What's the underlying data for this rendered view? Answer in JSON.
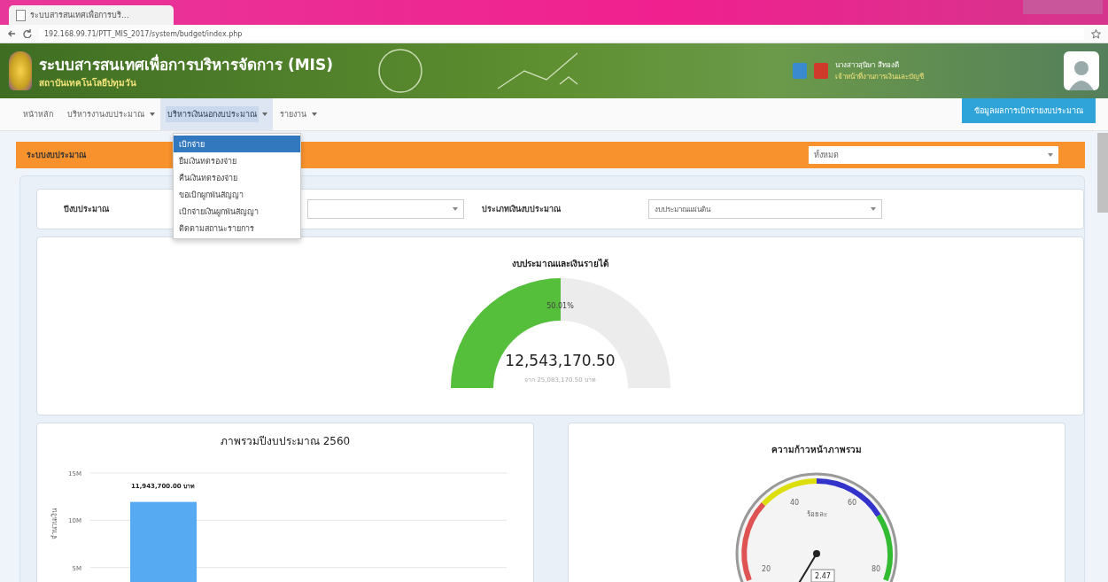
{
  "browser": {
    "tab_title": "ระบบสารสนเทศเพื่อการบริ...",
    "url": "192.168.99.71/PTT_MIS_2017/system/budget/index.php"
  },
  "header": {
    "title": "ระบบสารสนเทศเพื่อการบริหารจัดการ (MIS)",
    "subtitle": "สถาบันเทคโนโลยีปทุมวัน",
    "user_name": "นางสาวสุนิษา สีทองดี",
    "user_role": "เจ้าหน้าที่งานการเงินและบัญชี"
  },
  "nav": {
    "items": [
      {
        "label": "หน้าหลัก",
        "dropdown": false,
        "selected": false
      },
      {
        "label": "บริหารงานงบประมาณ",
        "dropdown": true,
        "selected": false
      },
      {
        "label": "บริหารเงินนอกงบประมาณ",
        "dropdown": true,
        "selected": true
      },
      {
        "label": "รายงาน",
        "dropdown": true,
        "selected": false
      }
    ],
    "action_button": "ข้อมูลผลการเบิกจ่ายงบประมาณ",
    "menu": [
      {
        "label": "เบิกจ่าย",
        "selected": true
      },
      {
        "label": "ยืมเงินทดรองจ่าย",
        "selected": false
      },
      {
        "label": "คืนเงินทดรองจ่าย",
        "selected": false
      },
      {
        "label": "ขอเบิกผูกพันสัญญา",
        "selected": false
      },
      {
        "label": "เบิกจ่ายเงินผูกพันสัญญา",
        "selected": false
      },
      {
        "label": "ติดตามสถานะรายการ",
        "selected": false
      }
    ]
  },
  "section": {
    "title": "ระบบงบประมาณ",
    "select_value": "ทั้งหมด"
  },
  "filters": [
    {
      "label": "ปีงบประมาณ"
    },
    {
      "label": "ประเภทเงินงบประมาณ",
      "value": "งบประมาณแผ่นดิน"
    }
  ],
  "budget_gauge": {
    "title": "งบประมาณและเงินรายได้",
    "percent": "50.01%",
    "value": "12,543,170.50",
    "sub": "จาก 25,083,170.50 บาท",
    "level": 0.5
  },
  "budget_chart": {
    "chart_data": {
      "type": "bar",
      "title": "ภาพรวมปีงบประมาณ 2560",
      "ylabel": "จำนวนเงิน",
      "values": [
        11943700
      ],
      "ylim": [
        0,
        15000000
      ],
      "yticks": [
        {
          "value": 5000000,
          "label": "5M"
        },
        {
          "value": 10000000,
          "label": "10M"
        },
        {
          "value": 15000000,
          "label": "15M"
        }
      ],
      "value_labels": [
        "11,943,700.00 บาท"
      ]
    }
  },
  "progress": {
    "title": "ความก้าวหน้าภาพรวม",
    "unit": "ร้อยละ",
    "scale": [
      "20",
      "40",
      "60",
      "80"
    ],
    "reading": "2.47"
  }
}
